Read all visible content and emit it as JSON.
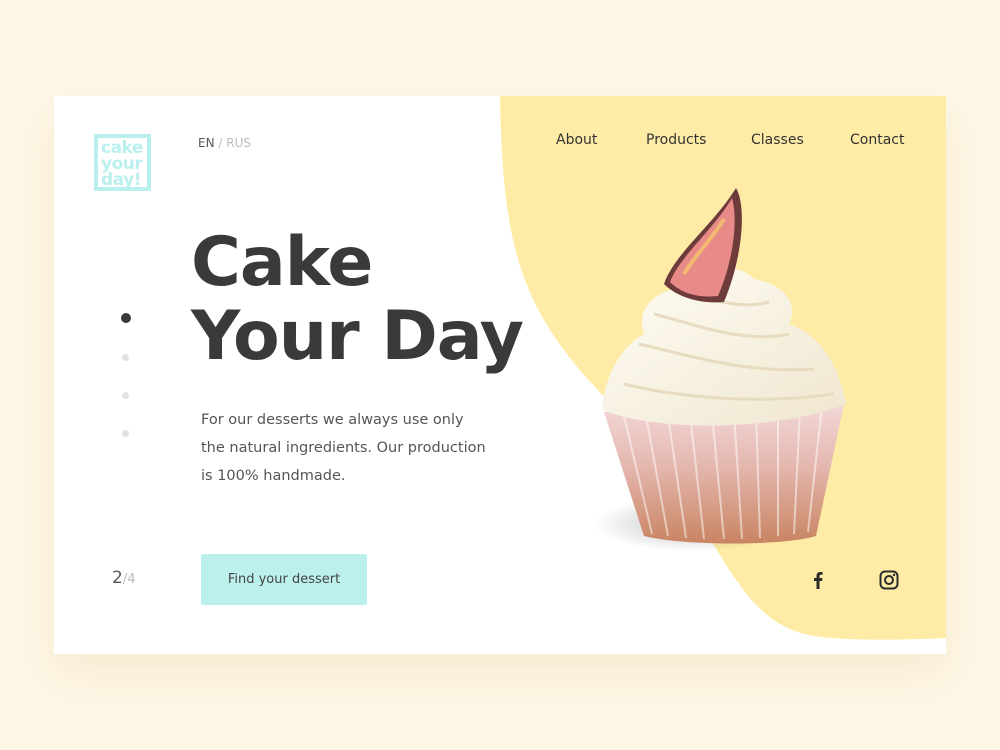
{
  "brand": {
    "logo_text": "cake\nyour\nday!",
    "logo_color": "#b9efed"
  },
  "language": {
    "active": "EN",
    "separator": " / ",
    "other": "RUS"
  },
  "nav": {
    "items": [
      {
        "label": "About"
      },
      {
        "label": "Products"
      },
      {
        "label": "Classes"
      },
      {
        "label": "Contact"
      }
    ]
  },
  "hero": {
    "title_line1": "Cake",
    "title_line2": "Your Day",
    "description": "For our desserts we always use only the natural ingredients. Our production is 100% handmade.",
    "cta_label": "Find your dessert",
    "image_alt": "cupcake with cream and fig slice"
  },
  "slider": {
    "current": "2",
    "total": "/4",
    "count": 4,
    "active_index": 1
  },
  "social": {
    "icons": [
      "facebook-icon",
      "instagram-icon"
    ]
  },
  "colors": {
    "accent_yellow": "#feeca6",
    "button": "#bbf0ec",
    "text_dark": "#3a3a3a",
    "page_bg": "#fef7e6"
  }
}
